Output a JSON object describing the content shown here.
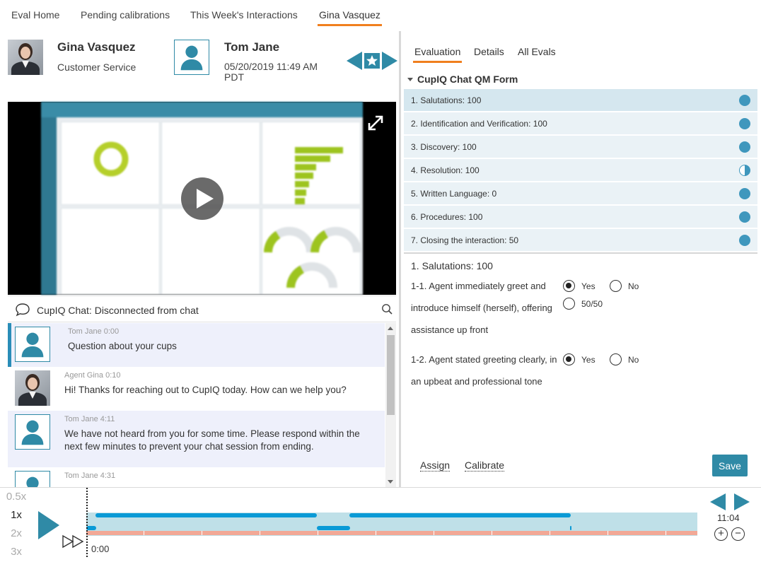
{
  "topnav": {
    "tabs": [
      {
        "label": "Eval Home"
      },
      {
        "label": "Pending calibrations"
      },
      {
        "label": "This Week's Interactions"
      },
      {
        "label": "Gina Vasquez"
      }
    ]
  },
  "agent": {
    "name": "Gina Vasquez",
    "department": "Customer Service"
  },
  "customer": {
    "name": "Tom Jane",
    "datetime": "05/20/2019 11:49 AM PDT"
  },
  "chat": {
    "header": "CupIQ Chat: Disconnected from chat",
    "messages": [
      {
        "author": "Tom Jane 0:00",
        "text": "Question about your cups"
      },
      {
        "author": "Agent Gina 0:10",
        "text": "Hi! Thanks for reaching out to CupIQ today. How can we help you?"
      },
      {
        "author": "Tom Jane 4:11",
        "text": "We have not heard from you for some time. Please respond within the next few minutes to prevent your chat session from ending."
      },
      {
        "author": "Tom Jane 4:31",
        "text": ""
      }
    ]
  },
  "right_tabs": [
    {
      "label": "Evaluation"
    },
    {
      "label": "Details"
    },
    {
      "label": "All Evals"
    }
  ],
  "form": {
    "title": "CupIQ Chat QM Form",
    "sections": [
      {
        "label": "1. Salutations: 100",
        "status": "full"
      },
      {
        "label": "2. Identification and Verification: 100",
        "status": "full"
      },
      {
        "label": "3. Discovery: 100",
        "status": "full"
      },
      {
        "label": "4. Resolution: 100",
        "status": "half"
      },
      {
        "label": "5. Written Language: 0",
        "status": "full"
      },
      {
        "label": "6. Procedures: 100",
        "status": "full"
      },
      {
        "label": "7. Closing the interaction: 50",
        "status": "full"
      }
    ],
    "current_section": "1. Salutations: 100",
    "questions": [
      {
        "text": "1-1. Agent immediately greet and introduce himself (herself), offering assistance up front",
        "options": [
          "Yes",
          "No",
          "50/50"
        ],
        "selected": "Yes"
      },
      {
        "text": "1-2. Agent stated greeting clearly, in an upbeat and professional tone",
        "options": [
          "Yes",
          "No"
        ],
        "selected": "Yes"
      }
    ],
    "assign_label": "Assign",
    "calibrate_label": "Calibrate",
    "save_label": "Save"
  },
  "player": {
    "speeds": [
      "0.5x",
      "1x",
      "2x",
      "3x"
    ],
    "selected_speed": "1x",
    "current_time": "0:00",
    "total_time": "11:04"
  },
  "colors": {
    "accent": "#2f8aa6",
    "tab_underline": "#f07f1e",
    "timeline_bg": "#bfe0e8",
    "timeline_segment": "#0a9ad6",
    "timeline_pink": "#f2a896"
  }
}
